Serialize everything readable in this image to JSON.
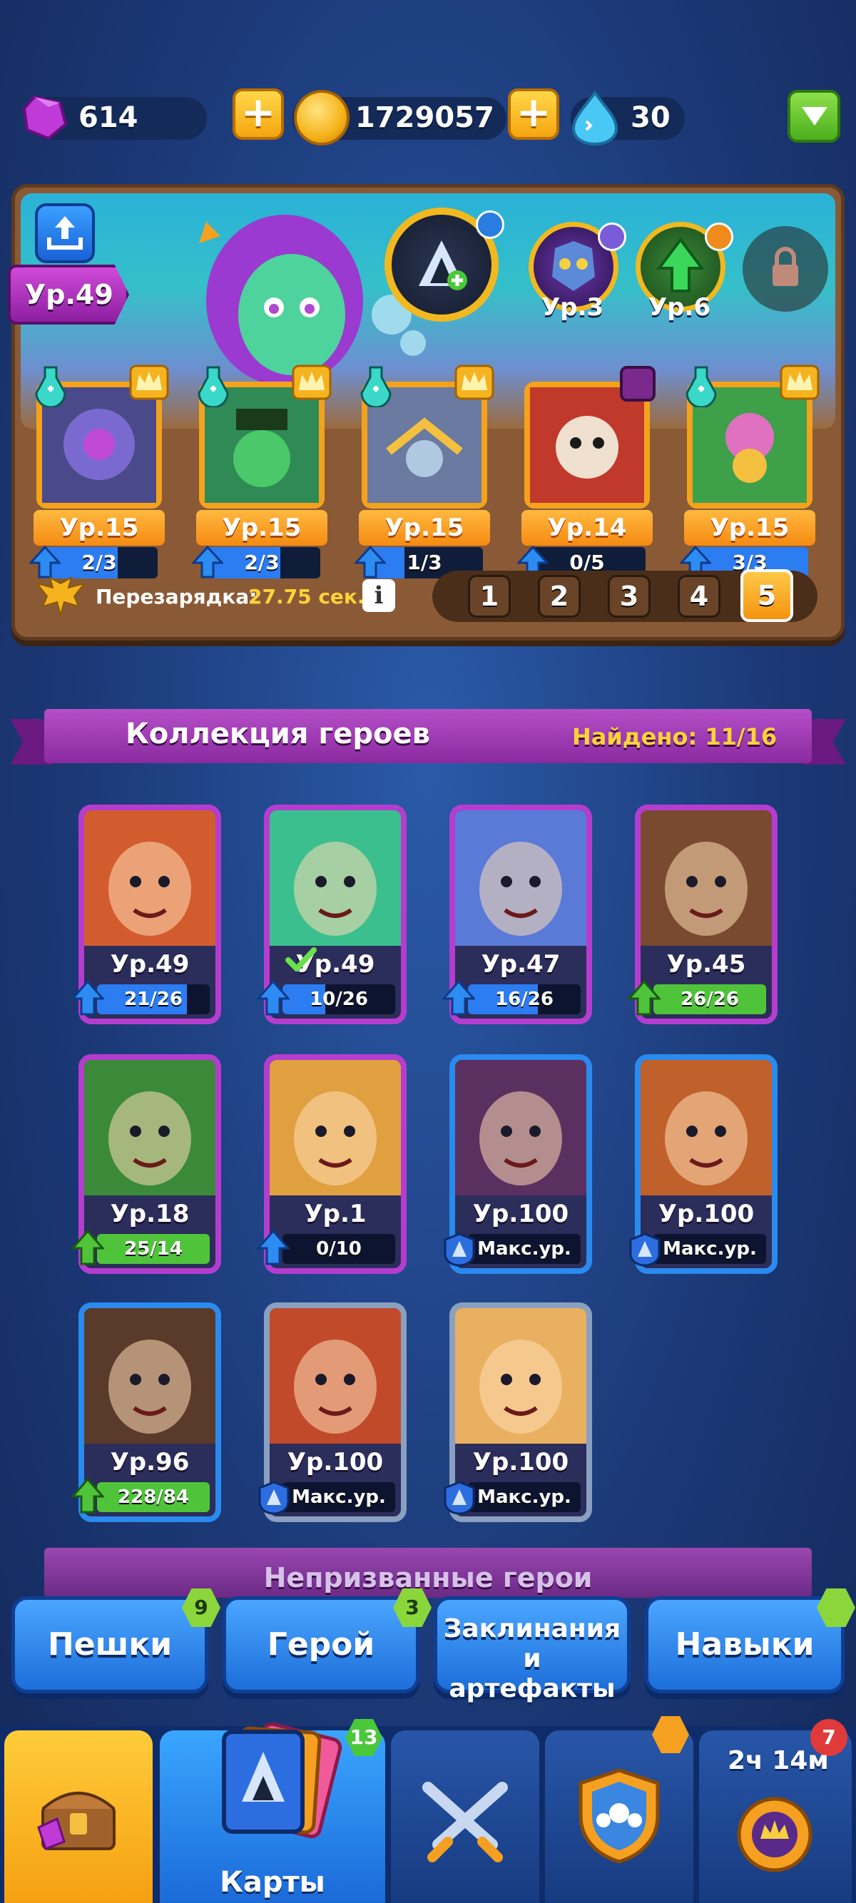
{
  "resources": {
    "gems": "614",
    "gold": "1729057",
    "drops": "30",
    "plus_symbol": "+"
  },
  "deck": {
    "player_level": "Ур.49",
    "slots": [
      {
        "level": "Ур.3",
        "badge_color": "#7a5cd8"
      },
      {
        "level": "Ур.6",
        "badge_color": "#f08a1a"
      }
    ],
    "cards": [
      {
        "level": "Ур.15",
        "progress": "2/3",
        "fill": 0.66,
        "art": "#4a4a8a"
      },
      {
        "level": "Ур.15",
        "progress": "2/3",
        "fill": 0.66,
        "art": "#2f8a55"
      },
      {
        "level": "Ур.15",
        "progress": "1/3",
        "fill": 0.33,
        "art": "#6a7aa0"
      },
      {
        "level": "Ур.14",
        "progress": "0/5",
        "fill": 0.0,
        "art": "#c0392b"
      },
      {
        "level": "Ур.15",
        "progress": "3/3",
        "fill": 1.0,
        "art": "#3fa04a"
      }
    ],
    "reload_label": "Перезарядка:",
    "reload_value": "27.75 сек.",
    "info": "i",
    "tabs": [
      "1",
      "2",
      "3",
      "4",
      "5"
    ],
    "active_tab": "5"
  },
  "collection": {
    "title": "Коллекция героев",
    "found": "Найдено: 11/16",
    "heroes": [
      {
        "level": "Ур.49",
        "progress": "21/26",
        "fill": 0.8,
        "frame": "purple",
        "bar": "blue",
        "art": "#d35c2e"
      },
      {
        "level": "Ур.49",
        "progress": "10/26",
        "fill": 0.38,
        "frame": "purple",
        "bar": "blue",
        "art": "#3bbf8f",
        "check": true
      },
      {
        "level": "Ур.47",
        "progress": "16/26",
        "fill": 0.62,
        "frame": "purple",
        "bar": "blue",
        "art": "#5a7ad8"
      },
      {
        "level": "Ур.45",
        "progress": "26/26",
        "fill": 1.0,
        "frame": "purple",
        "bar": "green",
        "art": "#7a4a30"
      },
      {
        "level": "Ур.18",
        "progress": "25/14",
        "fill": 1.0,
        "frame": "purple",
        "bar": "green",
        "art": "#3a8a3a"
      },
      {
        "level": "Ур.1",
        "progress": "0/10",
        "fill": 0.0,
        "frame": "purple",
        "bar": "blue",
        "art": "#e0a040"
      },
      {
        "level": "Ур.100",
        "progress": "Макс.ур.",
        "fill": 0.0,
        "frame": "blue",
        "bar": "max",
        "art": "#5a3060"
      },
      {
        "level": "Ур.100",
        "progress": "Макс.ур.",
        "fill": 0.0,
        "frame": "blue",
        "bar": "max",
        "art": "#c0602a"
      },
      {
        "level": "Ур.96",
        "progress": "228/84",
        "fill": 1.0,
        "frame": "blue",
        "bar": "green",
        "art": "#5a3a2a"
      },
      {
        "level": "Ур.100",
        "progress": "Макс.ур.",
        "fill": 0.0,
        "frame": "steel",
        "bar": "max",
        "art": "#c04a2a"
      },
      {
        "level": "Ур.100",
        "progress": "Макс.ур.",
        "fill": 0.0,
        "frame": "steel",
        "bar": "max",
        "art": "#e8b060"
      }
    ]
  },
  "uncalled_title": "Непризванные герои",
  "filters": [
    {
      "label": "Пешки",
      "badge": "9"
    },
    {
      "label": "Герой",
      "badge": "3"
    },
    {
      "label_line1": "Заклинания",
      "label_line2": "и артефакты"
    },
    {
      "label": "Навыки",
      "badge": ""
    }
  ],
  "nav": {
    "cards_label": "Карты",
    "cards_badge": "13",
    "trophy_badge": "7",
    "timer": "2ч 14м"
  }
}
